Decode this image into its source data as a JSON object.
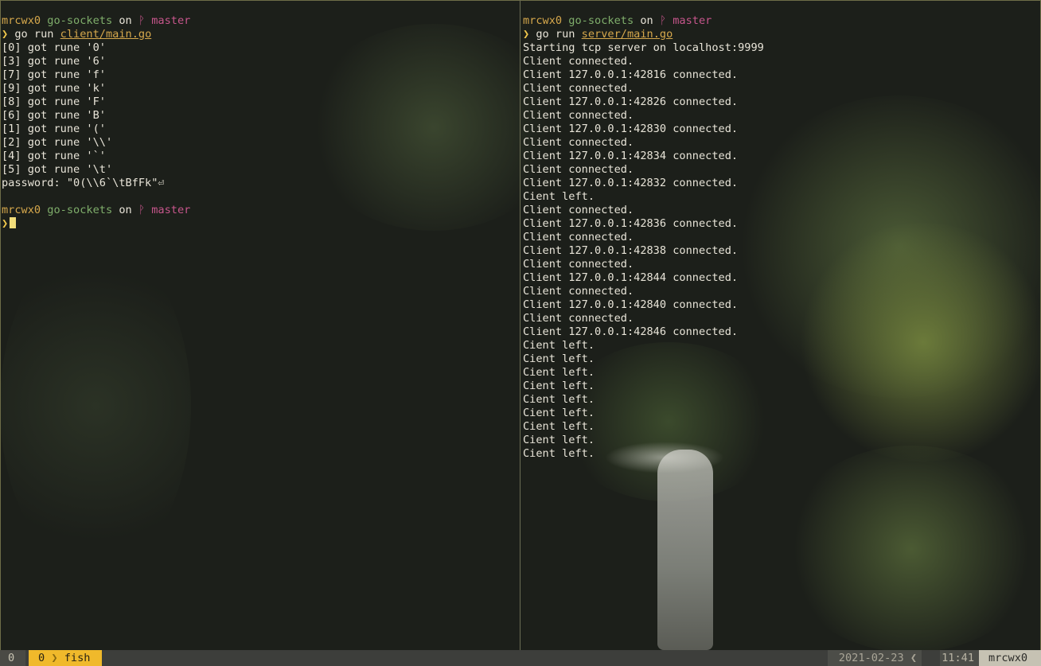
{
  "prompt": {
    "user": "mrcwx0",
    "dir": "go-sockets",
    "on": "on",
    "branch_icon": "branch-icon",
    "branch": "master",
    "arrow": "❯"
  },
  "left": {
    "cmd": "go run",
    "path": "client/main.go",
    "lines": [
      "[0] got rune '0'",
      "[3] got rune '6'",
      "[7] got rune 'f'",
      "[9] got rune 'k'",
      "[8] got rune 'F'",
      "[6] got rune 'B'",
      "[1] got rune '('",
      "[2] got rune '\\\\'",
      "[4] got rune '`'",
      "[5] got rune '\\t'",
      "password: \"0(\\\\6`\\tBfFk\"⏎"
    ]
  },
  "right": {
    "cmd": "go run",
    "path": "server/main.go",
    "lines": [
      "Starting tcp server on localhost:9999",
      "Client connected.",
      "Client 127.0.0.1:42816 connected.",
      "Client connected.",
      "Client 127.0.0.1:42826 connected.",
      "Client connected.",
      "Client 127.0.0.1:42830 connected.",
      "Client connected.",
      "Client 127.0.0.1:42834 connected.",
      "Client connected.",
      "Client 127.0.0.1:42832 connected.",
      "Cient left.",
      "Client connected.",
      "Client 127.0.0.1:42836 connected.",
      "Client connected.",
      "Client 127.0.0.1:42838 connected.",
      "Client connected.",
      "Client 127.0.0.1:42844 connected.",
      "Client connected.",
      "Client 127.0.0.1:42840 connected.",
      "Client connected.",
      "Client 127.0.0.1:42846 connected.",
      "Cient left.",
      "Cient left.",
      "Cient left.",
      "Cient left.",
      "Cient left.",
      "Cient left.",
      "Cient left.",
      "Cient left.",
      "Cient left."
    ]
  },
  "statusbar": {
    "session": "0",
    "window_index": "0",
    "window_name": "fish",
    "date": "2021-02-23",
    "time": "11:41",
    "host": "mrcwx0"
  },
  "colors": {
    "accent": "#f0b92b",
    "user": "#d6a84c",
    "dir": "#7fae6b",
    "branch": "#c7568c"
  }
}
